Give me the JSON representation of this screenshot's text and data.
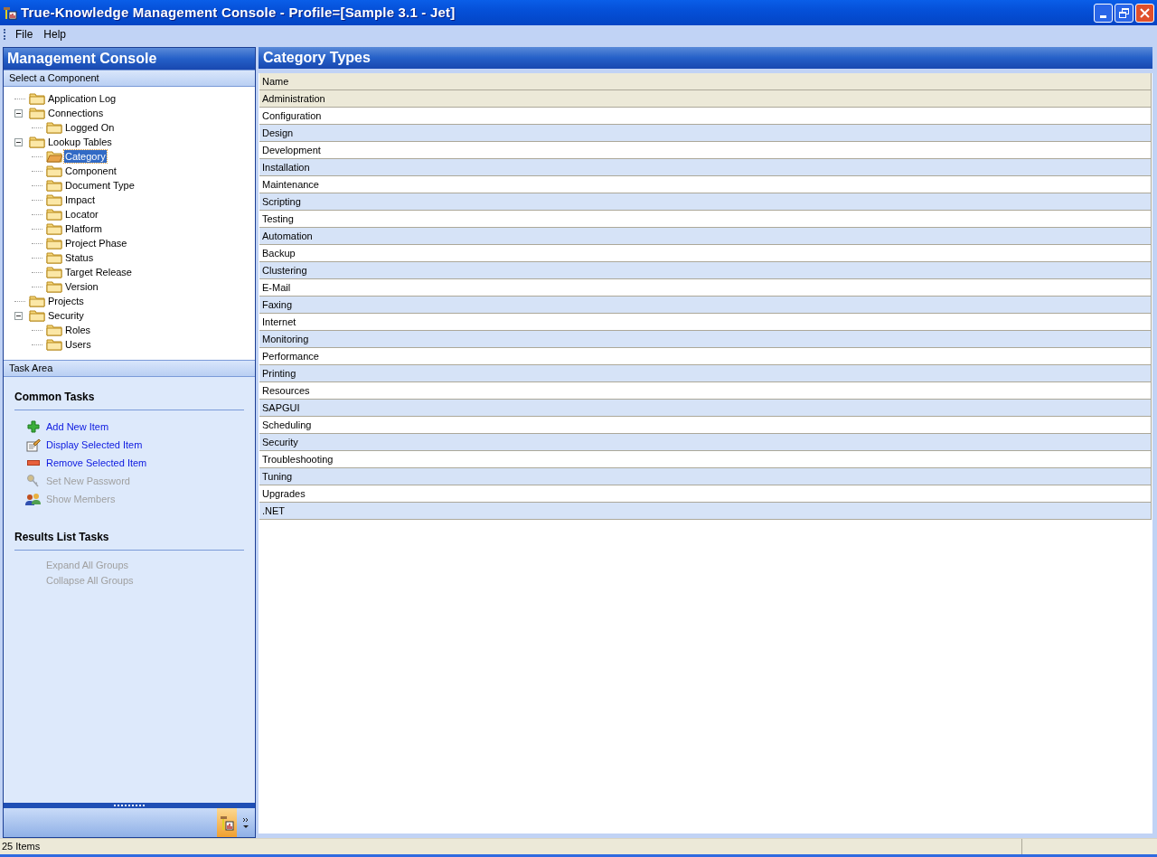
{
  "window": {
    "title": "True-Knowledge Management Console - Profile=[Sample 3.1 - Jet]"
  },
  "menu": [
    {
      "label": "File"
    },
    {
      "label": "Help"
    }
  ],
  "left_panel": {
    "title": "Management Console",
    "tree_header": "Select a Component",
    "tree": [
      {
        "label": "Application Log",
        "selected": false
      },
      {
        "label": "Connections",
        "selected": false,
        "expanded": true,
        "children": [
          {
            "label": "Logged On",
            "selected": false
          }
        ]
      },
      {
        "label": "Lookup Tables",
        "selected": false,
        "expanded": true,
        "children": [
          {
            "label": "Category",
            "selected": true
          },
          {
            "label": "Component",
            "selected": false
          },
          {
            "label": "Document Type",
            "selected": false
          },
          {
            "label": "Impact",
            "selected": false
          },
          {
            "label": "Locator",
            "selected": false
          },
          {
            "label": "Platform",
            "selected": false
          },
          {
            "label": "Project Phase",
            "selected": false
          },
          {
            "label": "Status",
            "selected": false
          },
          {
            "label": "Target Release",
            "selected": false
          },
          {
            "label": "Version",
            "selected": false
          }
        ]
      },
      {
        "label": "Projects",
        "selected": false
      },
      {
        "label": "Security",
        "selected": false,
        "expanded": true,
        "children": [
          {
            "label": "Roles",
            "selected": false
          },
          {
            "label": "Users",
            "selected": false
          }
        ]
      }
    ],
    "task_header": "Task Area",
    "task_groups": [
      {
        "title": "Common Tasks",
        "tasks": [
          {
            "label": "Add New Item",
            "kind": "add",
            "disabled": false
          },
          {
            "label": "Display Selected Item",
            "kind": "display",
            "disabled": false
          },
          {
            "label": "Remove Selected Item",
            "kind": "remove",
            "disabled": false
          },
          {
            "label": "Set New Password",
            "kind": "password",
            "disabled": true
          },
          {
            "label": "Show Members",
            "kind": "members",
            "disabled": true
          }
        ]
      },
      {
        "title": "Results List Tasks",
        "tasks": [
          {
            "label": "Expand All Groups",
            "kind": "none",
            "disabled": true
          },
          {
            "label": "Collapse All Groups",
            "kind": "none",
            "disabled": true
          }
        ]
      }
    ]
  },
  "content": {
    "title": "Category Types",
    "table": {
      "columns": [
        "Name"
      ],
      "rows": [
        {
          "name": "Administration",
          "selected": true
        },
        {
          "name": "Configuration",
          "selected": false
        },
        {
          "name": "Design",
          "selected": false
        },
        {
          "name": "Development",
          "selected": false
        },
        {
          "name": "Installation",
          "selected": false
        },
        {
          "name": "Maintenance",
          "selected": false
        },
        {
          "name": "Scripting",
          "selected": false
        },
        {
          "name": "Testing",
          "selected": false
        },
        {
          "name": "Automation",
          "selected": false
        },
        {
          "name": "Backup",
          "selected": false
        },
        {
          "name": "Clustering",
          "selected": false
        },
        {
          "name": "E-Mail",
          "selected": false
        },
        {
          "name": "Faxing",
          "selected": false
        },
        {
          "name": "Internet",
          "selected": false
        },
        {
          "name": "Monitoring",
          "selected": false
        },
        {
          "name": "Performance",
          "selected": false
        },
        {
          "name": "Printing",
          "selected": false
        },
        {
          "name": "Resources",
          "selected": false
        },
        {
          "name": "SAPGUI",
          "selected": false
        },
        {
          "name": "Scheduling",
          "selected": false
        },
        {
          "name": "Security",
          "selected": false
        },
        {
          "name": "Troubleshooting",
          "selected": false
        },
        {
          "name": "Tuning",
          "selected": false
        },
        {
          "name": "Upgrades",
          "selected": false
        },
        {
          "name": ".NET",
          "selected": false
        }
      ]
    }
  },
  "status_bar": {
    "text": "25 Items"
  }
}
